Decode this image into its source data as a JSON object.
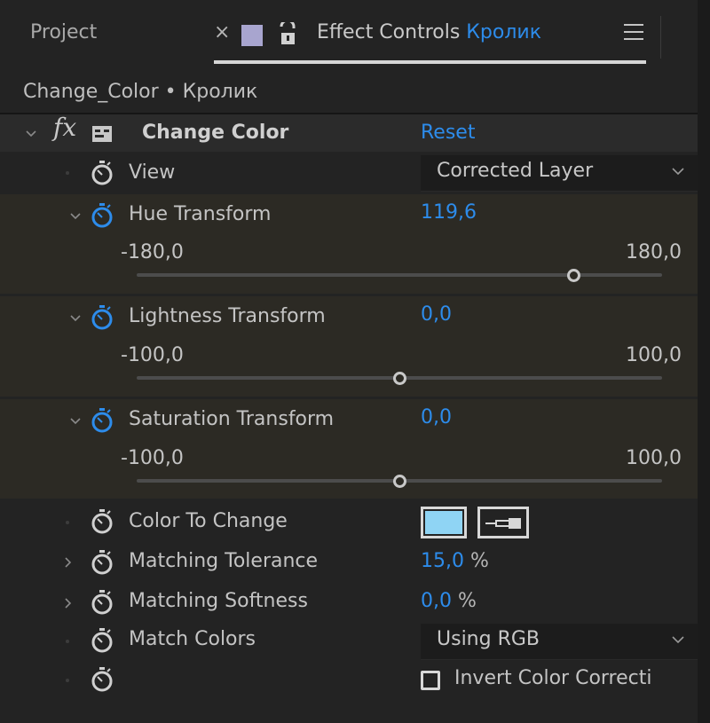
{
  "tabs": {
    "project": "Project",
    "close": "×",
    "effect_controls_prefix": "Effect Controls ",
    "effect_controls_layer": "Кролик",
    "swatch_color": "#a8a5cf"
  },
  "breadcrumb": "Change_Color • Кролик",
  "effect": {
    "name": "Change Color",
    "reset": "Reset"
  },
  "properties": {
    "view": {
      "label": "View",
      "value": "Corrected Layer"
    },
    "hue": {
      "label": "Hue Transform",
      "value": "119,6",
      "min": "-180,0",
      "max": "180,0",
      "level": 0.832
    },
    "lightness": {
      "label": "Lightness Transform",
      "value": "0,0",
      "min": "-100,0",
      "max": "100,0",
      "level": 0.5
    },
    "saturation": {
      "label": "Saturation Transform",
      "value": "0,0",
      "min": "-100,0",
      "max": "100,0",
      "level": 0.5
    },
    "color_to_change": {
      "label": "Color To Change",
      "color": "#8fd4f4"
    },
    "matching_tolerance": {
      "label": "Matching Tolerance",
      "value": "15,0",
      "unit": " %"
    },
    "matching_softness": {
      "label": "Matching Softness",
      "value": "0,0",
      "unit": " %"
    },
    "match_colors": {
      "label": "Match Colors",
      "value": "Using RGB"
    },
    "invert": {
      "label": "Invert Color Correcti",
      "checked": false
    }
  },
  "colors": {
    "accent": "#2d8ceb",
    "panel_bg": "#232323",
    "row_alt": "#2b2b2b",
    "group_bg": "#2c2a24"
  }
}
